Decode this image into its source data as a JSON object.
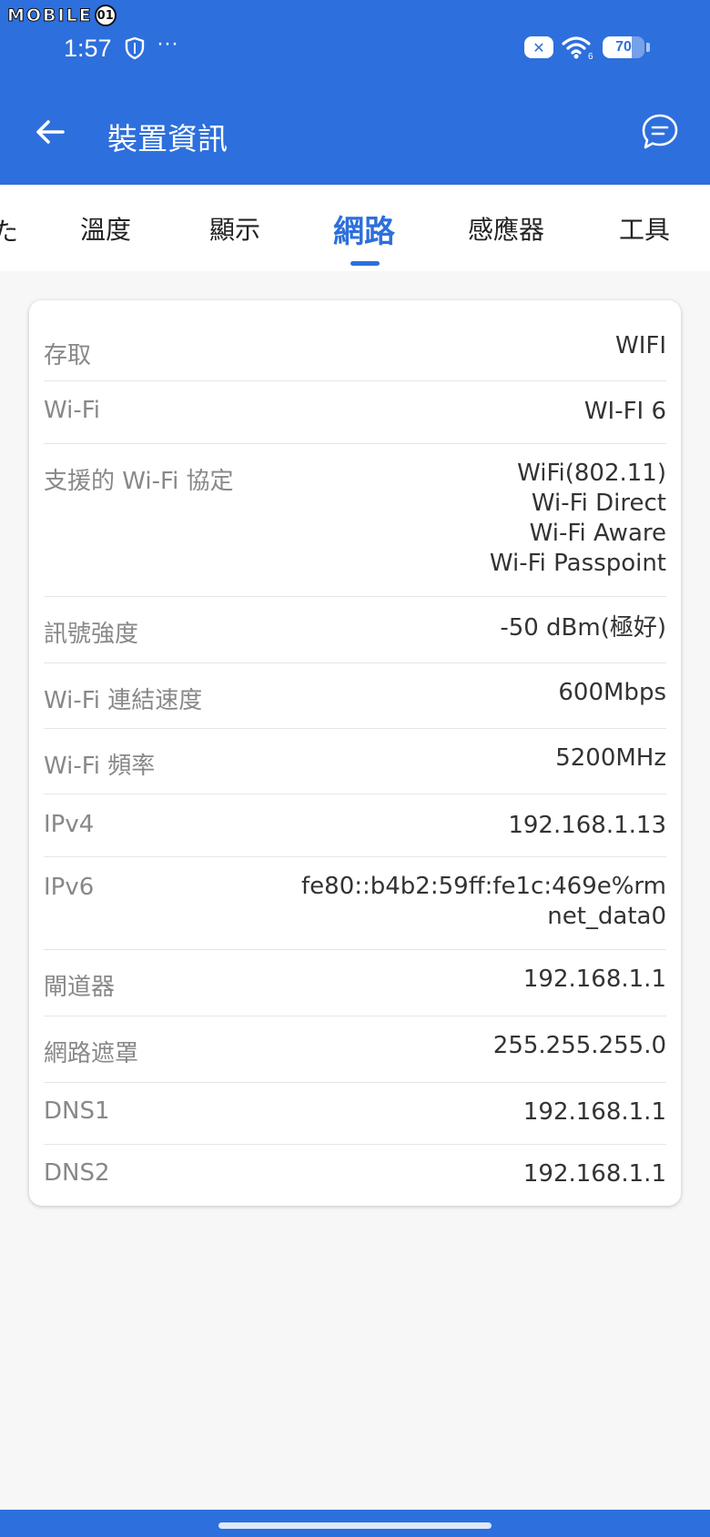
{
  "watermark": {
    "text": "MOBILE",
    "face": "01"
  },
  "status": {
    "time": "1:57",
    "dots": "···",
    "wifi_badge": "6",
    "battery": 70
  },
  "header": {
    "title": "裝置資訊"
  },
  "tabs": {
    "partial": "た",
    "items": [
      {
        "label": "溫度"
      },
      {
        "label": "顯示"
      },
      {
        "label": "網路"
      },
      {
        "label": "感應器"
      },
      {
        "label": "工具"
      }
    ],
    "active": "網路"
  },
  "rows": [
    {
      "label": "存取",
      "value": "WIFI"
    },
    {
      "label": "Wi-Fi",
      "value": "WI-FI 6"
    },
    {
      "label": "支援的 Wi-Fi 協定",
      "value_lines": [
        "WiFi(802.11)",
        "Wi-Fi Direct",
        "Wi-Fi Aware",
        "Wi-Fi Passpoint"
      ]
    },
    {
      "label": "訊號強度",
      "value": "-50 dBm(極好)"
    },
    {
      "label": "Wi-Fi 連結速度",
      "value": "600Mbps"
    },
    {
      "label": "Wi-Fi 頻率",
      "value": "5200MHz"
    },
    {
      "label": "IPv4",
      "value": "192.168.1.13"
    },
    {
      "label": "IPv6",
      "value_lines": [
        "fe80::b4b2:59ff:fe1c:469e%rm",
        "net_data0"
      ]
    },
    {
      "label": "閘道器",
      "value": "192.168.1.1"
    },
    {
      "label": "網路遮罩",
      "value": "255.255.255.0"
    },
    {
      "label": "DNS1",
      "value": "192.168.1.1"
    },
    {
      "label": "DNS2",
      "value": "192.168.1.1"
    }
  ]
}
